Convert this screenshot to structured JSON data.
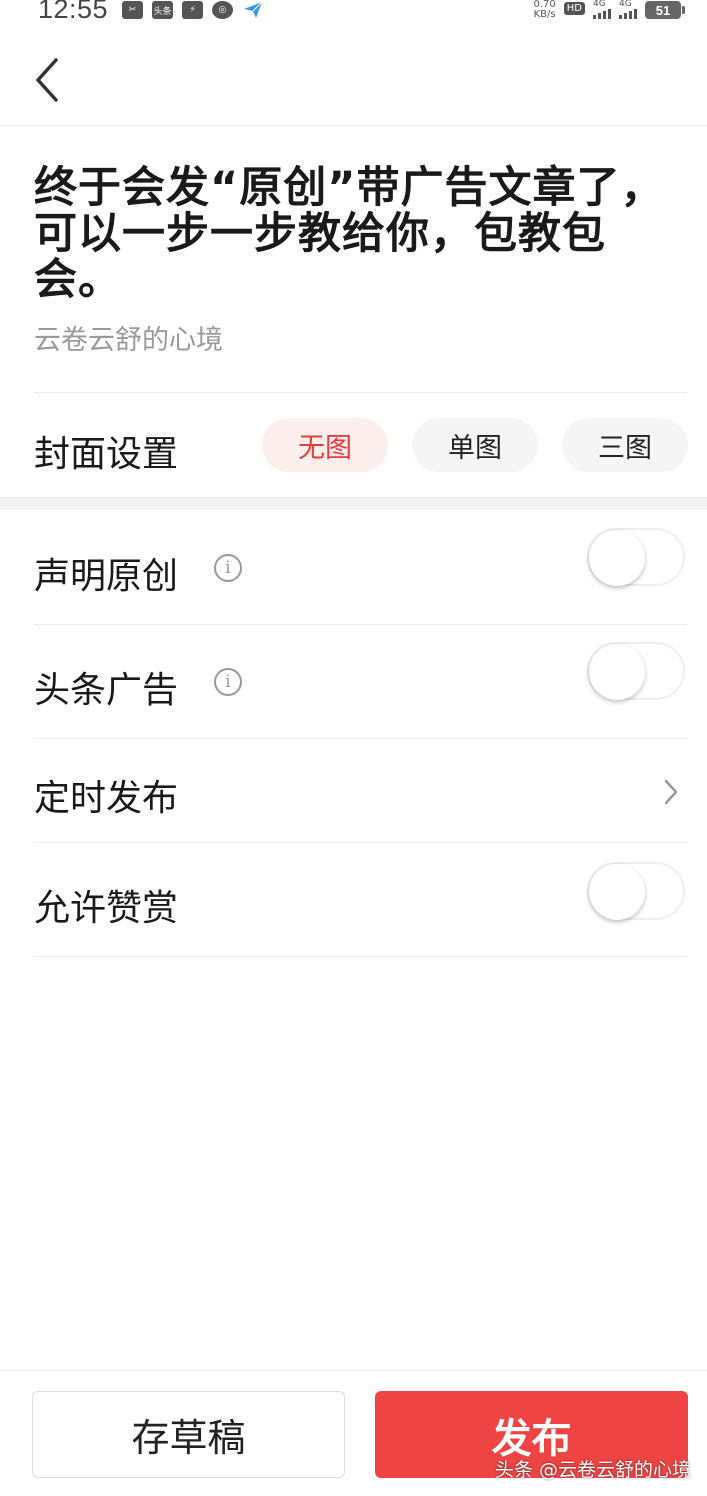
{
  "status_bar": {
    "time": "12:55",
    "netspeed_value": "0.70",
    "netspeed_unit": "KB/s",
    "hd": "HD",
    "signal1_label": "4G",
    "signal2_label": "4G",
    "battery": "51",
    "app_icons": [
      "scissors-icon",
      "toutiao-icon",
      "flash-icon",
      "clock-icon",
      "paper-plane-icon"
    ],
    "app_icon_labels": [
      "✂",
      "头条",
      "⚡",
      "◎",
      ""
    ]
  },
  "article": {
    "title": "终于会发“原创”带广告文章了，可以一步一步教给你，包教包会。",
    "author": "云卷云舒的心境"
  },
  "cover": {
    "label": "封面设置",
    "options": [
      "无图",
      "单图",
      "三图"
    ],
    "selected": "无图"
  },
  "settings": {
    "original": {
      "label": "声明原创",
      "info": "i",
      "enabled": false
    },
    "ads": {
      "label": "头条广告",
      "info": "i",
      "enabled": false
    },
    "scheduled": {
      "label": "定时发布"
    },
    "reward": {
      "label": "允许赞赏",
      "enabled": false
    }
  },
  "actions": {
    "draft": "存草稿",
    "publish": "发布"
  },
  "watermark": "头条 @云卷云舒的心境",
  "colors": {
    "accent": "#ee4444",
    "accent_light": "#fdeeee",
    "divider": "#ececec"
  }
}
